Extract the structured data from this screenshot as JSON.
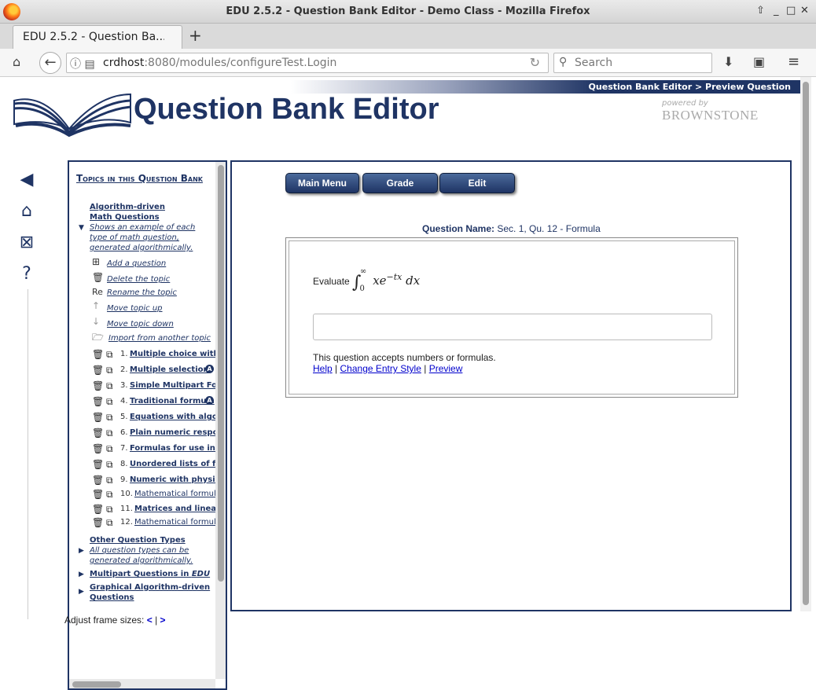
{
  "window": {
    "title": "EDU 2.5.2 - Question Bank Editor - Demo Class - Mozilla Firefox"
  },
  "tab": {
    "label": "EDU 2.5.2 - Question Ba..."
  },
  "url": {
    "host": "crdhost",
    "rest": ":8080/modules/configureTest.Login"
  },
  "search": {
    "placeholder": "Search"
  },
  "header": {
    "breadcrumb": "Question Bank Editor > Preview Question",
    "app_title": "Question Bank Editor",
    "powered_by": "powered by",
    "brand": "BROWNSTONE"
  },
  "sidebar": {
    "title": "Topics in this Question Bank",
    "topic1_line1": "Algorithm-driven",
    "topic1_line2": "Math Questions",
    "topic1_desc": [
      "Shows an example of each",
      "type of math question,",
      "generated algorithmically."
    ],
    "actions": {
      "add": "Add a question",
      "delete": "Delete the topic",
      "rename_prefix": "Re",
      "rename": "Rename the topic",
      "up": "Move topic up",
      "down": "Move topic down",
      "import": "Import from another topic"
    },
    "questions": [
      {
        "num": "1.",
        "label": "Multiple choice with c",
        "bold": true,
        "badge": false
      },
      {
        "num": "2.",
        "label": "Multiple selection",
        "bold": true,
        "badge": true
      },
      {
        "num": "3.",
        "label": "Simple Multipart Form",
        "bold": true,
        "badge": false
      },
      {
        "num": "4.",
        "label": "Traditional formula",
        "bold": true,
        "badge": true
      },
      {
        "num": "5.",
        "label": "Equations with algorit",
        "bold": true,
        "badge": false
      },
      {
        "num": "6.",
        "label": "Plain numeric respon",
        "bold": true,
        "badge": false
      },
      {
        "num": "7.",
        "label": "Formulas for use in in",
        "bold": true,
        "badge": false
      },
      {
        "num": "8.",
        "label": "Unordered lists of for",
        "bold": true,
        "badge": false
      },
      {
        "num": "9.",
        "label": "Numeric with physica",
        "bold": true,
        "badge": false
      },
      {
        "num": "10.",
        "label": "Mathematical formula",
        "bold": false,
        "badge": false
      },
      {
        "num": "11.",
        "label": "Matrices and linear a",
        "bold": true,
        "badge": false
      },
      {
        "num": "12.",
        "label": "Mathematical formula",
        "bold": false,
        "badge": false
      }
    ],
    "badge_letter": "A",
    "topic2": "Other Question Types",
    "topic2_desc": [
      "All question types can be",
      "generated algorithmically."
    ],
    "topic3_prefix": "Multipart Questions in ",
    "topic3_em": "EDU",
    "topic4_line1": "Graphical Algorithm-driven",
    "topic4_line2": "Questions"
  },
  "toolbar": {
    "main_menu": "Main Menu",
    "grade": "Grade",
    "edit": "Edit"
  },
  "question": {
    "name_label": "Question Name:",
    "name_value": "Sec. 1, Qu. 12 - Formula",
    "prompt": "Evaluate",
    "math_upper": "∞",
    "math_lower": "0",
    "math_body": "xe",
    "math_exp": "−tx",
    "math_dx": "dx",
    "accepts": "This question accepts numbers or formulas.",
    "help": "Help",
    "change_style": "Change Entry Style",
    "preview": "Preview",
    "sep": "|"
  },
  "footer": {
    "adjust": "Adjust frame sizes:",
    "less": "<",
    "sep": "|",
    "more": ">"
  },
  "colors": {
    "brand": "#1f3464",
    "link": "#0000cc"
  }
}
